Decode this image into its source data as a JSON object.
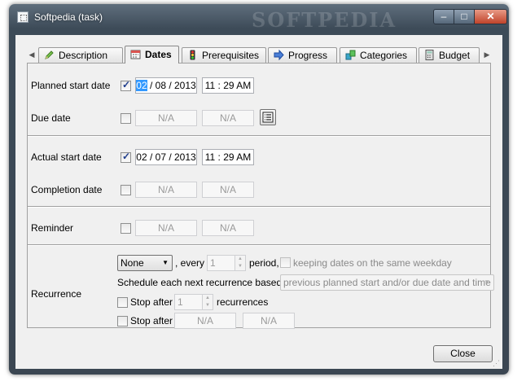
{
  "window": {
    "title": "Softpedia (task)",
    "watermark": "SOFTPEDIA",
    "minimize": "–",
    "maximize": "□",
    "close": "✕"
  },
  "tabs": [
    {
      "label": "Description",
      "icon": "pencil-icon"
    },
    {
      "label": "Dates",
      "icon": "calendar-icon",
      "active": true
    },
    {
      "label": "Prerequisites",
      "icon": "traffic-light-icon"
    },
    {
      "label": "Progress",
      "icon": "arrow-right-icon"
    },
    {
      "label": "Categories",
      "icon": "boxes-icon"
    },
    {
      "label": "Budget",
      "icon": "calculator-icon"
    }
  ],
  "tab_scroll": {
    "left": "◀",
    "right": "▶"
  },
  "dates": {
    "planned_start": {
      "label": "Planned start date",
      "checked": true,
      "day": "02",
      "date_rest": " / 08 / 2013",
      "time": "11 : 29  AM"
    },
    "due": {
      "label": "Due date",
      "checked": false,
      "date": "N/A",
      "time": "N/A"
    },
    "actual_start": {
      "label": "Actual start date",
      "checked": true,
      "date": "02 / 07 / 2013",
      "time": "11 : 29  AM"
    },
    "completion": {
      "label": "Completion date",
      "checked": false,
      "date": "N/A",
      "time": "N/A"
    },
    "reminder": {
      "label": "Reminder",
      "checked": false,
      "date": "N/A",
      "time": "N/A"
    }
  },
  "recurrence": {
    "label": "Recurrence",
    "type": "None",
    "every_text": ", every",
    "every_value": "1",
    "period_text": "period,",
    "same_weekday_label": "keeping dates on the same weekday",
    "schedule_label": "Schedule each next recurrence based on",
    "schedule_value": "previous planned start and/or due date and time",
    "stop_after_label": "Stop after",
    "stop_after_value": "1",
    "recurrences_label": "recurrences",
    "stop_after_date_label": "Stop after",
    "stop_after_date": "N/A",
    "stop_after_time": "N/A"
  },
  "buttons": {
    "close": "Close"
  },
  "colors": {
    "selection": "#3399ff",
    "titlebar": "#3d4b58",
    "close_button": "#c0432a"
  }
}
